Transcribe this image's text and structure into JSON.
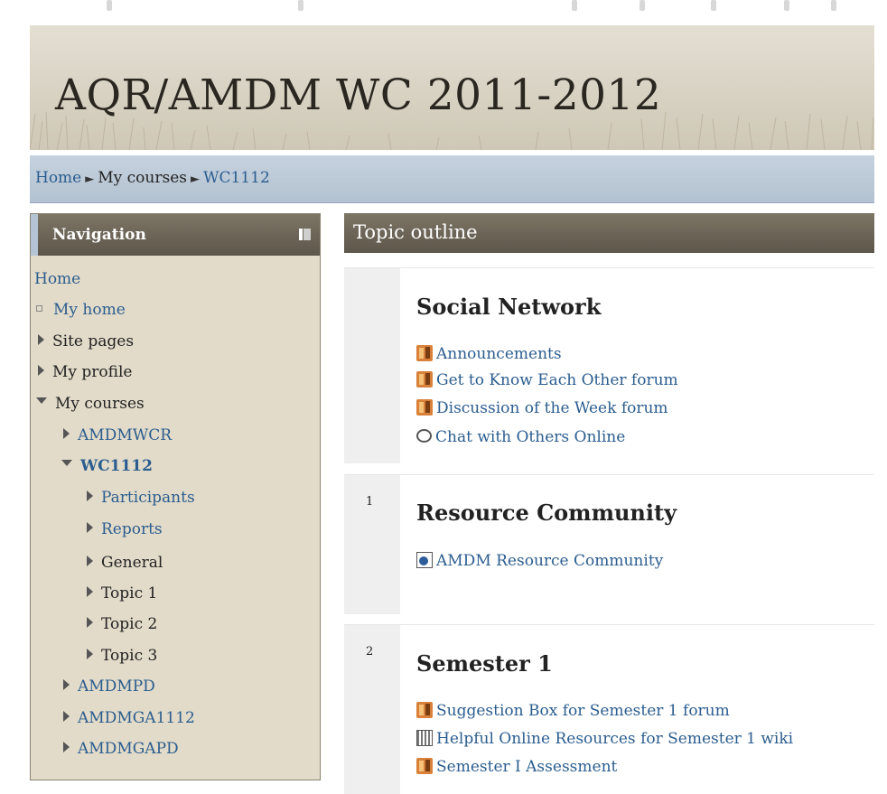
{
  "header": {
    "title": "AQR/AMDM WC 2011-2012"
  },
  "breadcrumb": [
    {
      "label": "Home",
      "link": true
    },
    {
      "label": "My courses",
      "link": false
    },
    {
      "label": "WC1112",
      "link": true
    }
  ],
  "breadcrumb_separator": "►",
  "navigation": {
    "title": "Navigation",
    "items": [
      {
        "label": "Home",
        "icon": "none",
        "link": true
      },
      {
        "label": "My home",
        "icon": "square-bullet-icon",
        "link": true
      },
      {
        "label": "Site pages",
        "icon": "triangle-right-icon",
        "link": false
      },
      {
        "label": "My profile",
        "icon": "triangle-right-icon",
        "link": false
      },
      {
        "label": "My courses",
        "icon": "triangle-down-icon",
        "link": false
      },
      {
        "label": "AMDMWCR",
        "icon": "triangle-right-icon",
        "link": true
      },
      {
        "label": "WC1112",
        "icon": "triangle-down-icon",
        "link": true
      },
      {
        "label": "Participants",
        "icon": "triangle-right-icon",
        "link": true
      },
      {
        "label": "Reports",
        "icon": "triangle-right-icon",
        "link": true
      },
      {
        "label": "General",
        "icon": "triangle-right-icon",
        "link": false
      },
      {
        "label": "Topic 1",
        "icon": "triangle-right-icon",
        "link": false
      },
      {
        "label": "Topic 2",
        "icon": "triangle-right-icon",
        "link": false
      },
      {
        "label": "Topic 3",
        "icon": "triangle-right-icon",
        "link": false
      },
      {
        "label": "AMDMPD",
        "icon": "triangle-right-icon",
        "link": true
      },
      {
        "label": "AMDMGA1112",
        "icon": "triangle-right-icon",
        "link": true
      },
      {
        "label": "AMDMGAPD",
        "icon": "triangle-right-icon",
        "link": true
      }
    ]
  },
  "topic_outline": {
    "title": "Topic outline",
    "sections": [
      {
        "number": "",
        "title": "Social Network",
        "activities": [
          {
            "label": "Announcements",
            "icon": "forum-icon"
          },
          {
            "label": "Get to Know Each Other forum",
            "icon": "forum-icon"
          },
          {
            "label": "Discussion of the Week forum",
            "icon": "forum-icon"
          },
          {
            "label": "Chat with Others Online",
            "icon": "chat-icon"
          }
        ]
      },
      {
        "number": "1",
        "title": "Resource Community",
        "activities": [
          {
            "label": "AMDM Resource Community",
            "icon": "page-icon"
          }
        ]
      },
      {
        "number": "2",
        "title": "Semester 1",
        "activities": [
          {
            "label": "Suggestion Box for Semester 1 forum",
            "icon": "forum-icon"
          },
          {
            "label": "Helpful Online Resources for Semester 1 wiki",
            "icon": "wiki-icon"
          },
          {
            "label": "Semester I Assessment",
            "icon": "forum-icon"
          }
        ]
      }
    ]
  },
  "colors": {
    "link": "#2b5d8f",
    "block_header": "#5d564a",
    "nav_background": "#e2dbc9",
    "breadcrumb_bar": "#b3c2d1"
  }
}
